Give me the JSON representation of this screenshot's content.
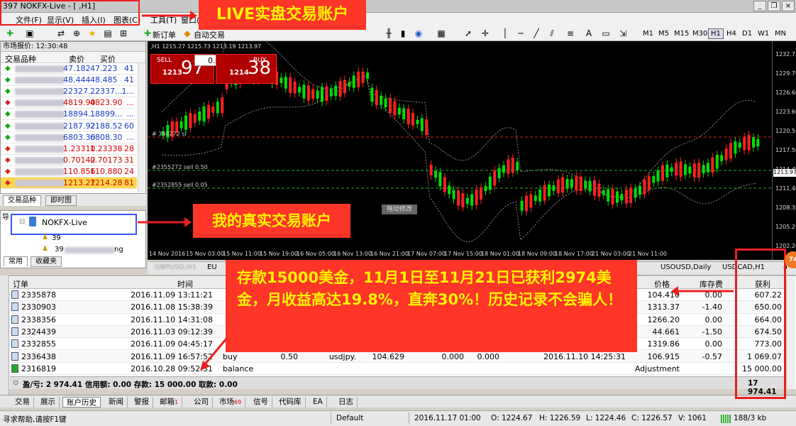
{
  "window": {
    "title": "397  NOKFX-Live - [          ,H1]"
  },
  "menu": [
    "文件(F)",
    "显示(V)",
    "插入(I)",
    "图表(C)",
    "工具(T)",
    "窗口("
  ],
  "toolbar": {
    "new_order": "新订单",
    "auto_trade": "自动交易",
    "timeframes": [
      "M1",
      "M5",
      "M15",
      "M30",
      "H1",
      "H4",
      "D1",
      "W1",
      "MN"
    ],
    "active_tf": "H1"
  },
  "market_watch": {
    "header": "市场报价: 12:30:48",
    "col_symbol": "交易品种",
    "col_bid": "卖价",
    "col_ask": "买价",
    "rows": [
      {
        "bid": "47.182",
        "ask": "47.223",
        "spread": "41",
        "dir": "up"
      },
      {
        "bid": "48.444",
        "ask": "48.485",
        "spread": "41",
        "dir": "up"
      },
      {
        "bid": "22327...",
        "ask": "22337...",
        "spread": "1...",
        "dir": "up"
      },
      {
        "bid": "4819.90",
        "ask": "4823.90",
        "spread": "...",
        "dir": "down"
      },
      {
        "bid": "18894...",
        "ask": "18899...",
        "spread": "...",
        "dir": "up"
      },
      {
        "bid": "2187.92",
        "ask": "2188.52",
        "spread": "60",
        "dir": "up"
      },
      {
        "bid": "6803.30",
        "ask": "6808.30",
        "spread": "...",
        "dir": "up"
      },
      {
        "bid": "1.23310",
        "ask": "1.23338",
        "spread": "28",
        "dir": "down"
      },
      {
        "bid": "0.70142",
        "ask": "0.70173",
        "spread": "31",
        "dir": "down"
      },
      {
        "bid": "110.856",
        "ask": "110.880",
        "spread": "24",
        "dir": "down"
      },
      {
        "bid": "1213.27",
        "ask": "1214.28",
        "spread": "81",
        "dir": "down"
      }
    ],
    "tabs": [
      "交易品种",
      "即时图"
    ]
  },
  "navigator": {
    "title": "导",
    "account": "NOKFX-Live",
    "sub1": "39",
    "sub2": "39",
    "sub2_tail": "ng",
    "tabs": [
      "常用",
      "收藏夹"
    ]
  },
  "chart": {
    "header": "          ,H1  1215.27 1215.73 1213.19 1213.97",
    "sell_label": "SELL",
    "buy_label": "BUY",
    "lot": "0.02",
    "sell_small": "1213",
    "sell_big": "97",
    "buy_small": "1214",
    "buy_big": "38",
    "line1": "#  358272 sl",
    "line2": "#2355272 sell 0.50",
    "line3": "#2352855 sell 0.05",
    "drag_hint": "拖动修改",
    "price_current": "1213.97",
    "y_labels": [
      "1232.75",
      "1229.70",
      "1226.60",
      "1223.60",
      "1220.55",
      "1217.50",
      "1214.45",
      "1211.40",
      "1208.35",
      "1205.25",
      "1202.20"
    ],
    "x_labels": [
      "14 Nov 2016",
      "15 Nov 03:00",
      "15 Nov 11:00",
      "15 Nov 19:00",
      "16 Nov 05:00",
      "16 Nov 13:00",
      "16 Nov 21:00",
      "17 Nov 07:00",
      "17 Nov 15:00",
      "18 Nov 01:00",
      "18 Nov 09:00",
      "18 Nov 17:00",
      "21 Nov 03:00",
      "21 Nov 11:00"
    ],
    "tabs": [
      "GBPUSD,H1",
      "EU",
      "USOUSD,Daily",
      "USDCAD,H1"
    ]
  },
  "terminal": {
    "headers": {
      "order": "订单",
      "time": "时间",
      "price": "价格",
      "swap": "库存费",
      "profit": "获利"
    },
    "rows": [
      {
        "order": "2335878",
        "time": "2016.11.09 13:11:21",
        "type": "",
        "size": "",
        "symbol": "",
        "price1": "",
        "sl": "",
        "tp": "",
        "close_time": "",
        "price": "104.410",
        "swap": "0.00",
        "profit": "607.22"
      },
      {
        "order": "2330903",
        "time": "2016.11.08 15:38:39",
        "type": "",
        "size": "",
        "symbol": "",
        "price1": "",
        "sl": "",
        "tp": "",
        "close_time": "",
        "price": "1313.37",
        "swap": "-1.40",
        "profit": "650.00"
      },
      {
        "order": "2338356",
        "time": "2016.11.10 14:31:08",
        "type": "",
        "size": "",
        "symbol": "",
        "price1": "",
        "sl": "",
        "tp": "",
        "close_time": "",
        "price": "1266.20",
        "swap": "0.00",
        "profit": "664.00"
      },
      {
        "order": "2324439",
        "time": "2016.11.03 09:12:39",
        "type": "",
        "size": "",
        "symbol": "",
        "price1": "",
        "sl": "",
        "tp": "",
        "close_time": "",
        "price": "44.661",
        "swap": "-1.50",
        "profit": "674.50"
      },
      {
        "order": "2332855",
        "time": "2016.11.09 04:45:17",
        "type": "",
        "size": "",
        "symbol": "",
        "price1": "",
        "sl": "",
        "tp": "",
        "close_time": "",
        "price": "1319.86",
        "swap": "0.00",
        "profit": "773.00"
      },
      {
        "order": "2336438",
        "time": "2016.11.09 16:57:52",
        "type": "buy",
        "size": "0.50",
        "symbol": "usdjpy.",
        "price1": "104.629",
        "sl": "0.000",
        "tp": "0.000",
        "close_time": "2016.11.10 14:25:31",
        "price": "106.915",
        "swap": "-0.57",
        "profit": "1 069.07"
      },
      {
        "order": "2316819",
        "time": "2016.10.28 09:52:31",
        "type": "balance",
        "size": "",
        "symbol": "",
        "price1": "",
        "sl": "",
        "tp": "",
        "close_time": "",
        "price": "Adjustment",
        "swap": "",
        "profit": "15 000.00"
      }
    ],
    "total": "盈/亏: 2 974.41  信用额: 0.00  存款: 15 000.00  取款: 0.00",
    "total_profit": "17 974.41"
  },
  "bottom_tabs": [
    {
      "label": "交易"
    },
    {
      "label": "展示"
    },
    {
      "label": "账户历史",
      "active": true
    },
    {
      "label": "新闻"
    },
    {
      "label": "警报"
    },
    {
      "label": "邮箱",
      "badge": "1"
    },
    {
      "label": "公司"
    },
    {
      "label": "市场",
      "badge": "69"
    },
    {
      "label": "信号"
    },
    {
      "label": "代码库"
    },
    {
      "label": "EA"
    },
    {
      "label": "日志"
    }
  ],
  "status": {
    "help": "寻求帮助,请按F1键",
    "profile": "Default",
    "datetime": "2016.11.17 01:00",
    "open": "O: 1224.67",
    "high": "H: 1226.59",
    "low": "L: 1224.46",
    "close": "C: 1226.57",
    "volume": "V: 1061",
    "traffic": "188/3 kb"
  },
  "annotations": {
    "live": "LIVE实盘交易账户",
    "real": "我的真实交易账户",
    "deposit": "存款15000美金，11月1日至11月21日已获利2974美金，月收益高达19.8%，直奔30%！历史记录不会骗人！"
  },
  "colors": {
    "up": "#00c800",
    "down": "#e00000",
    "callout_bg": "#ff3527",
    "callout_text": "#fff200"
  },
  "badge_corner": "74"
}
